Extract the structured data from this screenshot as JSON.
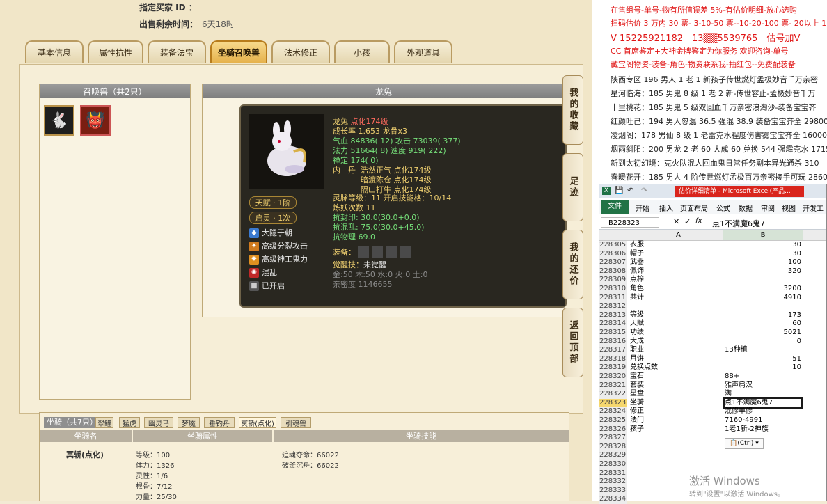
{
  "header": {
    "buyer_label": "指定买家 ID ：",
    "remain_label": "出售剩余时间：",
    "remain_value": "6天18时"
  },
  "tabs": [
    "基本信息",
    "属性抗性",
    "装备法宝",
    "坐骑召唤兽",
    "法术修正",
    "小孩",
    "外观道具"
  ],
  "active_tab": "坐骑召唤兽",
  "pet_list": {
    "title": "召唤兽（共2只）"
  },
  "pet_detail": {
    "title": "龙兔"
  },
  "tooltip": {
    "name": "龙兔",
    "name_suffix": "点化174级",
    "growth": "成长率 1.653 龙骨x3",
    "hp": "气血 84836( 12) 攻击 73039( 377)",
    "mp": "法力 51664( 8) 速度 919( 222)",
    "zen": "禅定 174( 0)",
    "core_label": "内　丹",
    "cores": [
      "浩然正气 点化174级",
      "暗渡陈仓 点化174级",
      "隔山打牛 点化174级"
    ],
    "spirit": "灵脉等级：11 开启技能格：10/14",
    "refine": "炼妖次数 11",
    "resist1": "抗封印: 30.0(30.0+0.0)",
    "resist2": "抗混乱: 75.0(30.0+45.0)",
    "resist3": "抗物理 69.0",
    "talent_badge": "天赋 · 1阶",
    "spirit_badge": "启灵 · 1次",
    "skills": [
      "大隐于朝",
      "高级分裂攻击",
      "高级神工鬼力",
      "混乱",
      "已开启"
    ],
    "equip_label": "装备：",
    "awaken": "觉醒技：",
    "awaken_value": "未觉醒",
    "elements": "金:50 木:50 水:0 火:0 土:0",
    "intimacy": "亲密度 1146655"
  },
  "side_buttons": [
    "我的收藏",
    "足迹",
    "我的还价",
    "返回顶部"
  ],
  "mount": {
    "title": "坐骑（共7只）",
    "tabs": [
      "翠鲤",
      "猛虎",
      "幽灵马",
      "梦魇",
      "垂钓舟",
      "冥轿(点化)",
      "引魂兽"
    ],
    "active": "冥轿(点化)",
    "head_name": "坐骑名",
    "head_attr": "坐骑属性",
    "head_skill": "坐骑技能",
    "name": "冥轿(点化)",
    "stats": [
      "等级：100",
      "体力：1326",
      "灵性：1/6",
      "根骨：7/12",
      "力量：25/30"
    ],
    "skills": [
      "追魂夺命：66022",
      "破釜沉舟：66022"
    ]
  },
  "notes": [
    "在售组号-单号-物有所值误差 5%-有估价明细-放心选购",
    "扫码估价 3 万内 30 票- 3-10-50 票--10-20-100 票- 20以上 150",
    "V 15225921182　13▒▒5539765　估号加V",
    "CC 首席鉴定+大神金牌鉴定为你服务 欢迎咨询-单号",
    "藏宝阁物资-装备-角色-物资联系我-抽红包--免费配装备",
    "陕西专区 196 男人 1 老 1 新孩子传世燃灯孟极妙音千万亲密",
    "星河临海：185 男鬼 8 级 1 老 2 新-传世容止-孟极妙音千万",
    "十里桃花：185 男鬼 5 级双回血千万亲密浪淘沙-装备宝宝齐",
    "红颜吐己：194 男人忽混 36.5 强混 38.9 装备宝宝齐全 29800",
    "凌烟阁：178 男仙 8 级 1 老雷克水程度伤害雾宝宝齐全 16000",
    "烟雨斜阳：200 男龙 2 老 60 大成 60 兑换 544 强霹克水 171518",
    "新到太初幻境：克火队混人回血鬼日常任务副本异光通杀 310",
    "春暖花开：185 男人 4 阶传世燃灯孟极百万亲密接手可玩 2860"
  ],
  "excel": {
    "title": "估价详细清单 - Microsoft Excel(产品...",
    "ribbon": [
      "文件",
      "开始",
      "插入",
      "页面布局",
      "公式",
      "数据",
      "审阅",
      "视图",
      "开发工"
    ],
    "namebox": "B228323",
    "formula": "点1不满魔6鬼7",
    "col_a": "A",
    "col_b": "B",
    "rows": [
      {
        "n": "228305",
        "a": "衣服",
        "b": "30"
      },
      {
        "n": "228306",
        "a": "帽子",
        "b": "30"
      },
      {
        "n": "228307",
        "a": "武器",
        "b": "100"
      },
      {
        "n": "228308",
        "a": "佩饰",
        "b": "320"
      },
      {
        "n": "228309",
        "a": "点榨",
        "b": ""
      },
      {
        "n": "228310",
        "a": "角色",
        "b": "3200"
      },
      {
        "n": "228311",
        "a": "共计",
        "b": "4910"
      },
      {
        "n": "228312",
        "a": "",
        "b": ""
      },
      {
        "n": "228313",
        "a": "等级",
        "b": "173"
      },
      {
        "n": "228314",
        "a": "天赋",
        "b": "60"
      },
      {
        "n": "228315",
        "a": "功绩",
        "b": "5021"
      },
      {
        "n": "228316",
        "a": "大成",
        "b": "0"
      },
      {
        "n": "228317",
        "a": "职业",
        "b": "13种植"
      },
      {
        "n": "228318",
        "a": "月饼",
        "b": "51"
      },
      {
        "n": "228319",
        "a": "兑换点数",
        "b": "10"
      },
      {
        "n": "228320",
        "a": "宝石",
        "b": "88+"
      },
      {
        "n": "228321",
        "a": "套装",
        "b": "雅声肩汉"
      },
      {
        "n": "228322",
        "a": "星盘",
        "b": "满"
      },
      {
        "n": "228323",
        "a": "坐骑",
        "b": "点1不满魔6鬼7"
      },
      {
        "n": "228324",
        "a": "修正",
        "b": "混修单修"
      },
      {
        "n": "228325",
        "a": "法门",
        "b": "7160-4991"
      },
      {
        "n": "228326",
        "a": "孩子",
        "b": "1老1新-2神族"
      },
      {
        "n": "228327",
        "a": "",
        "b": ""
      },
      {
        "n": "228328",
        "a": "",
        "b": ""
      },
      {
        "n": "228329",
        "a": "",
        "b": ""
      },
      {
        "n": "228330",
        "a": "",
        "b": ""
      },
      {
        "n": "228331",
        "a": "",
        "b": ""
      },
      {
        "n": "228332",
        "a": "",
        "b": ""
      },
      {
        "n": "228333",
        "a": "",
        "b": ""
      },
      {
        "n": "228334",
        "a": "",
        "b": ""
      }
    ],
    "paste_tip": "(Ctrl) ▾"
  },
  "watermark": [
    "激活 Windows",
    "转到\"设置\"以激活 Windows。"
  ]
}
